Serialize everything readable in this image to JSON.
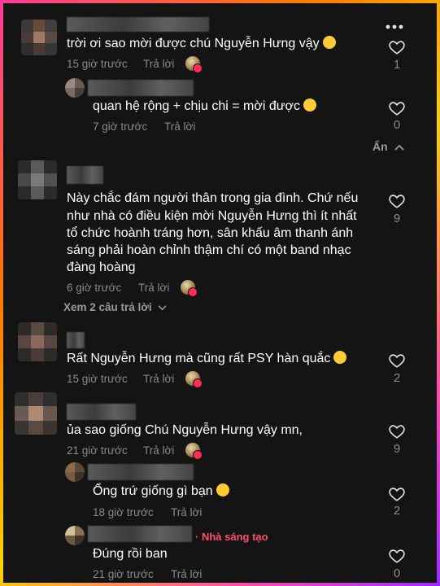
{
  "comments": [
    {
      "text_lines": [
        "trời ơi sao mời được chú Nguyễn Hưng vậy"
      ],
      "emoji": "loudly-crying-face",
      "time": "15 giờ trước",
      "reply_label": "Trả lời",
      "likes": "1"
    },
    {
      "text_lines": [
        "quan hệ rộng + chịu chi = mời được"
      ],
      "emoji": "grinning-face",
      "time": "7 giờ trước",
      "reply_label": "Trả lời",
      "likes": "0"
    },
    {
      "text_lines": [
        "Này chắc đám người thân trong gia đình. Chứ nếu",
        "như nhà có điều kiện mời Nguyễn Hưng thì ít nhất",
        "tổ chức hoành tráng hơn, sân khấu âm thanh ánh",
        "sáng phải hoàn chỉnh thậm chí có một band nhạc",
        "đàng hoàng"
      ],
      "time": "6 giờ trước",
      "reply_label": "Trả lời",
      "likes": "9"
    },
    {
      "text_lines": [
        "Rất Nguyễn Hưng mà cũng rất PSY hàn quắc"
      ],
      "emoji": "smiling-face",
      "time": "15 giờ trước",
      "reply_label": "Trả lời",
      "likes": "2"
    },
    {
      "text_lines": [
        "ủa sao giống Chú Nguyễn Hưng vậy mn,"
      ],
      "time": "21 giờ trước",
      "reply_label": "Trả lời",
      "likes": "9"
    },
    {
      "text_lines": [
        "Ổng trứ giống gì bạn"
      ],
      "emoji": "rolling-laughing-face",
      "time": "18 giờ trước",
      "reply_label": "Trả lời",
      "likes": "2"
    },
    {
      "text_lines": [
        "Đúng rồi ban"
      ],
      "time": "21 giờ trước",
      "reply_label": "Trả lời",
      "likes": "0",
      "badge": "· Nhà sáng tạo"
    }
  ],
  "hide_label": "Ẩn",
  "view_replies_label": "Xem 2 câu trả lời",
  "icons": {
    "like": "heart-outline-icon",
    "more": "more-dots-icon",
    "chevron_up": "chevron-up-icon",
    "chevron_down": "chevron-down-icon"
  },
  "colors": {
    "background": "#141414",
    "text": "#ffffff",
    "muted": "#8a8a8a",
    "creator": "#ff4d6d"
  }
}
